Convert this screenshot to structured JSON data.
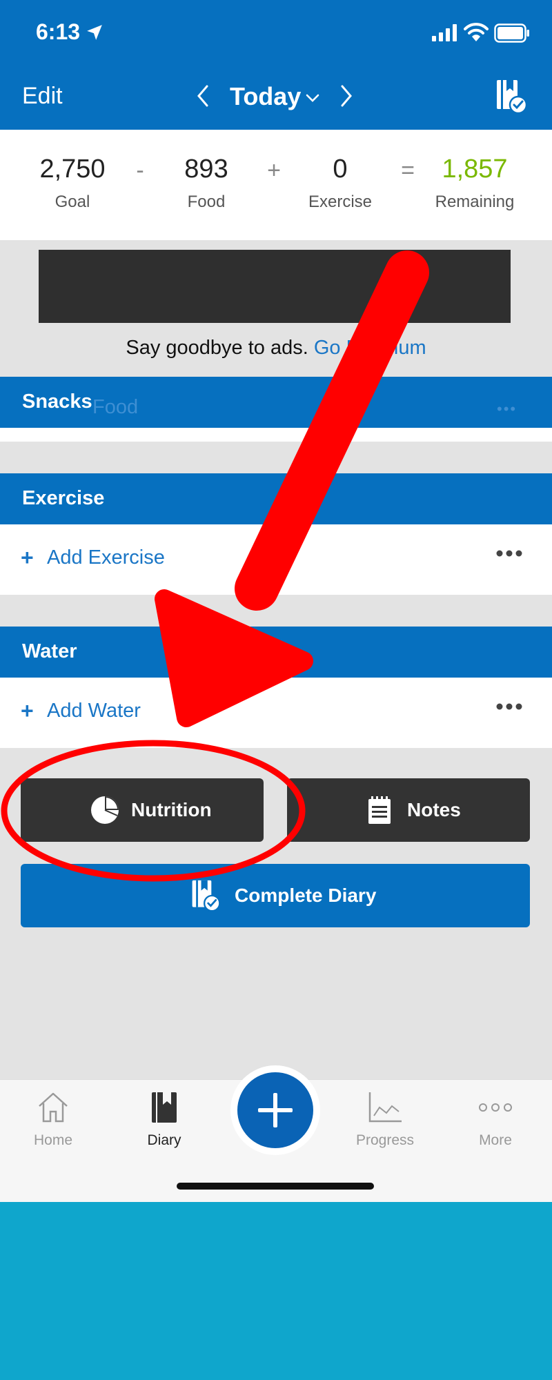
{
  "status_bar": {
    "time": "6:13"
  },
  "header": {
    "edit_label": "Edit",
    "date_label": "Today",
    "icons": {
      "prev": "chevron-left-icon",
      "next": "chevron-right-icon",
      "complete": "diary-check-icon"
    }
  },
  "summary": {
    "goal": {
      "value": "2,750",
      "label": "Goal"
    },
    "minus": "-",
    "food": {
      "value": "893",
      "label": "Food"
    },
    "plus": "+",
    "exercise": {
      "value": "0",
      "label": "Exercise"
    },
    "equals": "=",
    "remaining": {
      "value": "1,857",
      "label": "Remaining"
    },
    "remaining_color": "#7ab800"
  },
  "ad": {
    "text": "Say goodbye to ads. ",
    "link_text": "Go Premium"
  },
  "sections": {
    "snacks": {
      "title": "Snacks",
      "ghost_text": "Food"
    },
    "exercise": {
      "title": "Exercise",
      "add_label": "Add Exercise"
    },
    "water": {
      "title": "Water",
      "add_label": "Add Water"
    }
  },
  "buttons": {
    "nutrition": "Nutrition",
    "notes": "Notes",
    "complete_diary": "Complete Diary"
  },
  "tabbar": {
    "items": [
      {
        "label": "Home",
        "icon": "home-icon"
      },
      {
        "label": "Diary",
        "icon": "diary-icon"
      },
      {
        "label": "",
        "icon": "plus-icon"
      },
      {
        "label": "Progress",
        "icon": "chart-icon"
      },
      {
        "label": "More",
        "icon": "more-icon"
      }
    ],
    "active": "Diary"
  },
  "colors": {
    "brand_blue": "#0670bf",
    "link_blue": "#1a76c6",
    "annotation_red": "#ff0000",
    "bottom_background": "#0fa6cc"
  }
}
